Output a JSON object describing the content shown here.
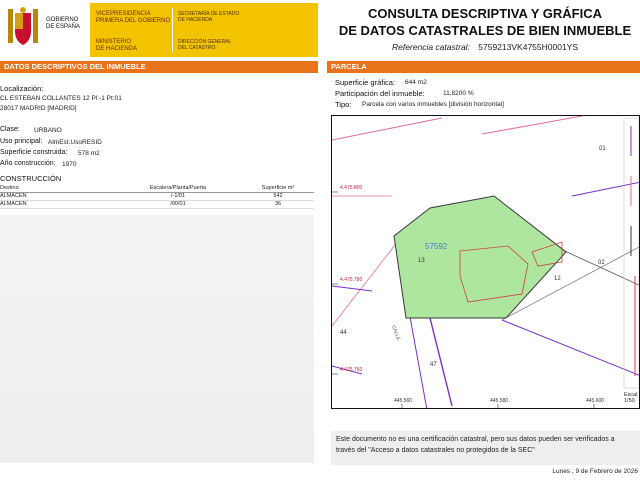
{
  "header": {
    "gob_logo_lines": [
      "GOBIERNO",
      "DE ESPAÑA"
    ],
    "band": {
      "line1": [
        "VICEPRESIDENCIA",
        "PRIMERA DEL GOBIERNO"
      ],
      "line2": [
        "MINISTERIO",
        "DE HACIENDA"
      ],
      "line3": [
        "SECRETARÍA DE ESTADO",
        "DE HACIENDA"
      ],
      "line4": [
        "DIRECCIÓN GENERAL",
        "DEL CATASTRO"
      ]
    },
    "title_line1": "CONSULTA DESCRIPTIVA Y GRÁFICA",
    "title_line2": "DE DATOS CATASTRALES DE BIEN INMUEBLE",
    "ref_label": "Referencia catastral:",
    "ref_value": "5759213VK4755H0001YS",
    "brand_color": "#f4c300",
    "accent_color": "#e8731a"
  },
  "left": {
    "bar_title": "DATOS DESCRIPTIVOS DEL INMUEBLE",
    "localizacion_label": "Localización:",
    "address_line1": "CL ESTEBAN COLLANTES 12 Pl:-1 Pt:01",
    "address_line2": "28017 MADRID [MADRID]",
    "clase_label": "Clase:",
    "clase_value": "URBANO",
    "uso_label": "Uso principal:",
    "uso_value": "AlmEst.UsoRESID",
    "sup_label": "Superficie construida:",
    "sup_value": "578 m2",
    "anio_label": "Año construcción:",
    "anio_value": "1970",
    "construccion_title": "CONSTRUCCIÓN",
    "table_headers": [
      "Destino",
      "Escalera/Planta/Puerta",
      "Superficie m²"
    ],
    "table_rows": [
      [
        "ALMACEN",
        "/-1/01",
        "542"
      ],
      [
        "ALMACEN",
        "/00/01",
        "36"
      ]
    ]
  },
  "right": {
    "bar_title": "PARCELA",
    "sup_grafica_label": "Superficie gráfica:",
    "sup_grafica_value": "644 m2",
    "participacion_label": "Participación del inmueble:",
    "participacion_value": "11,8200 %",
    "tipo_label": "Tipo:",
    "tipo_value": "Parcela con varios inmuebles [división horizontal]",
    "map_labels": {
      "parcel_id": "57592",
      "n13": "13",
      "n12": "12",
      "n02": "02",
      "n01": "01",
      "n44": "44",
      "n47": "47",
      "calle": "CALLE",
      "coord_y1": "4.475.800",
      "coord_y2": "4.475.760",
      "coord_y3": "4.475.780",
      "coord_x1": "445.560",
      "coord_x2": "445.580",
      "coord_x3": "445.600",
      "escala_label": "Escal",
      "escala_value": "1/50"
    },
    "disclaimer": "Este documento no es una certificación catastral, pero sus datos pueden ser verificados a través del \"Acceso a datos catastrales no protegidos de la SEC\"",
    "date": "Lunes , 9 de Febrero de 2026"
  }
}
